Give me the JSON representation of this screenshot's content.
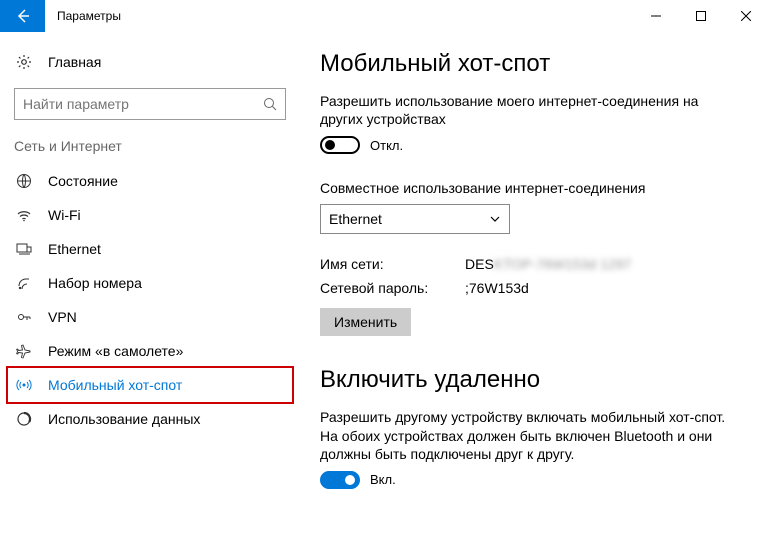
{
  "window": {
    "title": "Параметры"
  },
  "sidebar": {
    "home": "Главная",
    "search_placeholder": "Найти параметр",
    "group": "Сеть и Интернет",
    "items": [
      {
        "label": "Состояние"
      },
      {
        "label": "Wi-Fi"
      },
      {
        "label": "Ethernet"
      },
      {
        "label": "Набор номера"
      },
      {
        "label": "VPN"
      },
      {
        "label": "Режим «в самолете»"
      },
      {
        "label": "Мобильный хот-спот"
      },
      {
        "label": "Использование данных"
      }
    ]
  },
  "page": {
    "heading": "Мобильный хот-спот",
    "share_desc": "Разрешить использование моего интернет-соединения на других устройствах",
    "toggle_off": "Откл.",
    "share_from_label": "Совместное использование интернет-соединения",
    "share_from_value": "Ethernet",
    "network_name_label": "Имя сети:",
    "network_name_value": "DESKTOP-76W153d",
    "network_pass_label": "Сетевой пароль:",
    "network_pass_value": ";76W153d",
    "edit_button": "Изменить",
    "remote_heading": "Включить удаленно",
    "remote_desc": "Разрешить другому устройству включать мобильный хот-спот. На обоих устройствах должен быть включен Bluetooth и они должны быть подключены друг к другу.",
    "toggle_on": "Вкл."
  }
}
